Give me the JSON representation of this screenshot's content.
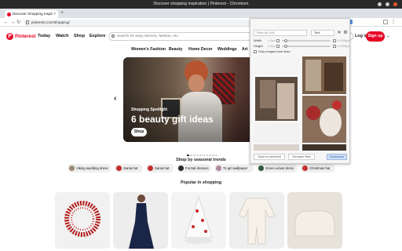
{
  "window": {
    "title": "Discover shopping inspiration | Pinterest - Chromium"
  },
  "browser": {
    "tab_title": "Discover Shopping Inspir",
    "tab_close": "×",
    "new_tab": "+",
    "url": "pinterest.com/shopping/",
    "back": "←",
    "forward": "→",
    "reload": "↻"
  },
  "header": {
    "logo_letter": "P",
    "brand": "Pinterest",
    "nav": [
      "Today",
      "Watch",
      "Shop",
      "Explore"
    ],
    "search_placeholder": "Search for easy dinners, fashion, etc.",
    "login": "Log in",
    "signup": "Sign up",
    "chevron": "⌄"
  },
  "categories": [
    "Women's Fashion",
    "Beauty",
    "Home Decor",
    "Weddings",
    "Art"
  ],
  "hero": {
    "eyebrow": "Shopping Spotlight",
    "headline": "6 beauty gift ideas",
    "cta": "Shop",
    "prev": "‹",
    "dots_total": 10,
    "dots_active": 0
  },
  "trends": {
    "title": "Shop by seasonal trends",
    "items": [
      "Viking wedding dress",
      "Santa hat",
      "Santa hat",
      "Formal dresses",
      "Tv girl wallpaper",
      "Green velvet dress",
      "Christmas hat"
    ]
  },
  "popular": {
    "title": "Popular in shopping",
    "items": [
      "red berry wreath",
      "navy evening gown",
      "white christmas tree",
      "baby footed pajamas",
      "cream curved sofa"
    ]
  },
  "overlay": {
    "filter_placeholder": "Filter by URL",
    "type_select": "Text",
    "width_label": "Width",
    "height_label": "Height",
    "min_prefix": "≥ 0px",
    "max_suffix": "≤ 0000px",
    "only_images_label": "Only images from links",
    "save_btn": "Save to selected",
    "rename_btn": "Rename files",
    "download_btn": "Download",
    "close": "✕",
    "settings": "⚙"
  }
}
